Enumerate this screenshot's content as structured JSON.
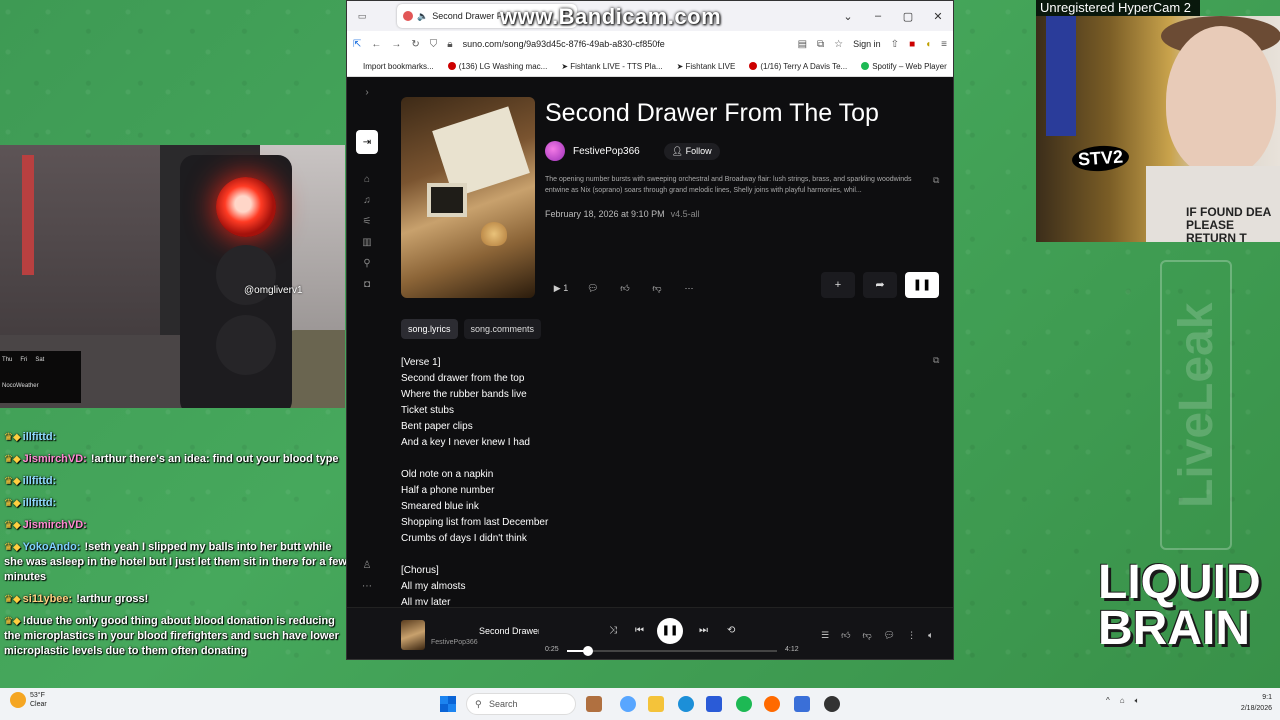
{
  "watermarks": {
    "bandicam": "www.Bandicam.com",
    "hypercam": "Unregistered HyperCam 2"
  },
  "traffic_cam": {
    "handle": "@omgliverv1",
    "weather": {
      "days": [
        "Thu",
        "Fri",
        "Sat"
      ],
      "brand": "NocoWeather"
    }
  },
  "chat": {
    "messages": [
      {
        "name": "illfittd:",
        "text": "",
        "color": "#8fd9ff"
      },
      {
        "name": "JismirchVD:",
        "text": "!arthur there's an idea: find out your blood type",
        "color": "#ff8ad2"
      },
      {
        "name": "illfittd:",
        "text": "",
        "color": "#8fd9ff"
      },
      {
        "name": "illfittd:",
        "text": "",
        "color": "#8fd9ff"
      },
      {
        "name": "JismirchVD:",
        "text": "",
        "color": "#ff8ad2"
      },
      {
        "name": "YokoAndo:",
        "text": "!seth yeah I slipped my balls into her butt while she was asleep in the hotel but I just let them sit in there for a few minutes",
        "color": "#7fd2ff"
      },
      {
        "name": "si11ybee:",
        "text": "!arthur gross!",
        "color": "#ffd080"
      },
      {
        "name": "",
        "text": "!duue the only good thing about blood donation is reducing the microplastics in your blood firefighters and such have lower microplastic levels due to them often donating",
        "color": "#ff6060"
      }
    ]
  },
  "browser": {
    "tab_title": "Second Drawer Fr",
    "url": "suno.com/song/9a93d45c-87f6-49ab-a830-cf850fe",
    "sign_in": "Sign in",
    "bookmarks": [
      "Import bookmarks...",
      "(136) LG Washing mac...",
      "Fishtank LIVE - TTS Pla...",
      "Fishtank LIVE",
      "(1/16) Terry A Davis Te...",
      "Spotify – Web Player"
    ]
  },
  "song": {
    "title": "Second Drawer From The Top",
    "artist": "FestivePop366",
    "follow": "Follow",
    "description": "The opening number bursts with sweeping orchestral and Broadway flair: lush strings, brass, and sparkling woodwinds entwine as Nix (soprano) soars through grand melodic lines, Shelly joins with playful harmonies, whil...",
    "date": "February 18, 2026 at 9:10 PM",
    "version": "v4.5-all",
    "play_count": "1",
    "tabs": [
      "song.lyrics",
      "song.comments"
    ],
    "lyrics": [
      "[Verse 1]",
      "Second drawer from the top",
      "Where the rubber bands live",
      "Ticket stubs",
      "Bent paper clips",
      "And a key I never knew I had",
      "",
      "Old note on a napkin",
      "Half a phone number",
      "Smeared blue ink",
      "Shopping list from last December",
      "Crumbs of days I didn't think",
      "",
      "[Chorus]",
      "All my almosts",
      "All my later"
    ]
  },
  "player": {
    "title": "Second Drawer From The Top",
    "artist": "FestivePop366",
    "elapsed": "0:25",
    "duration": "4:12",
    "progress": 0.099
  },
  "webcam": {
    "sticker": "STV2",
    "shirt_text": "IF FOUND DEA PLEASE RETURN T"
  },
  "overlay": {
    "liveleak": "LiveLeak",
    "liquid_line1": "LIQUID",
    "liquid_line2": "BRAIN"
  },
  "taskbar": {
    "temp": "53°F",
    "condition": "Clear",
    "search": "Search",
    "time": "9:1",
    "date": "2/18/2026"
  }
}
